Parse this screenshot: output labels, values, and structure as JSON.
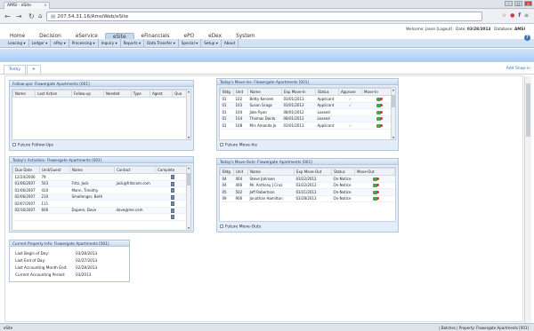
{
  "browser": {
    "tab_title": "AMSI - eSite",
    "url": "207.54.31.16/AmsiWeb/eSite"
  },
  "header": {
    "welcome_label": "Welcome: ",
    "user": "Jason [Logout]",
    "date_label": "Date: ",
    "date": "03/28/2013",
    "database_label": "Database: ",
    "database": "AMSI"
  },
  "main_nav": [
    "Home",
    "Decision",
    "eService",
    "eSite",
    "eFinancials",
    "ePO",
    "eDex",
    "System"
  ],
  "sub_nav": [
    "Leasing ▾",
    "Ledger ▾",
    "ePay ▾",
    "Processing ▾",
    "Inquiry ▾",
    "Reports ▾",
    "Data Transfer ▾",
    "Special ▾",
    "Setup ▾",
    "About"
  ],
  "page_tabs": {
    "active": "Today",
    "add": "+",
    "add_snapin": "Add Snap-in"
  },
  "followups": {
    "title": "Follow-ups: Flowergate Apartments [001]",
    "columns": [
      "Name",
      "Last Action",
      "Follow-up",
      "Needed",
      "Type",
      "Agent",
      "Que"
    ],
    "checkbox": "Future Follow-Ups"
  },
  "activities": {
    "title": "Today's Activities: Flowergate Apartments [001]",
    "columns": [
      "Due Date",
      "Unit/Guest",
      "Name",
      "Contact",
      "Complete"
    ],
    "rows": [
      [
        "12/24/2006",
        "79",
        "",
        ""
      ],
      [
        "01/06/2007",
        "503",
        "Fritz, Jack",
        "jack@fritzcom.com"
      ],
      [
        "01/06/2007",
        "410",
        "Mann, Timothy",
        ""
      ],
      [
        "02/06/2007",
        "210",
        "Smallenger, Beth",
        ""
      ],
      [
        "02/07/2007",
        "111",
        "",
        ""
      ],
      [
        "02/16/2007",
        "606",
        "Dupere, Dave",
        "dave@me.com"
      ],
      [
        "",
        "",
        "",
        ""
      ]
    ]
  },
  "move_ins": {
    "title": "Today's Move-Ins: Flowergate Apartments [001]",
    "columns": [
      "Bldg",
      "Unit",
      "Name",
      "Exp Move-In",
      "Status",
      "Approve",
      "Move-In"
    ],
    "rows": [
      [
        "01",
        "102",
        "Betty Kersem",
        "03/01/2013",
        "Applicant",
        "✓"
      ],
      [
        "01",
        "103",
        "Susan Grags",
        "03/01/2013",
        "Applicant",
        "✓"
      ],
      [
        "01",
        "104",
        "Jake Ryan",
        "08/01/2012",
        "Leased",
        ""
      ],
      [
        "01",
        "104",
        "Thomas Donla",
        "08/01/2012",
        "Leased",
        ""
      ],
      [
        "01",
        "108",
        "Mrs Amanda Jo",
        "03/01/2013",
        "Applicant",
        "✓"
      ]
    ],
    "checkbox": "Future Move-Ins"
  },
  "move_outs": {
    "title": "Today's Move-Outs: Flowergate Apartments [001]",
    "columns": [
      "Bldg",
      "Unit",
      "Name",
      "Exp Move-Out",
      "Status",
      "Move-Out"
    ],
    "rows": [
      [
        "04",
        "404",
        "Steve Johnson",
        "03/22/2012",
        "On-Notice"
      ],
      [
        "04",
        "406",
        "Mr. Anthony J Cruz",
        "03/22/2012",
        "On-Notice"
      ],
      [
        "05",
        "502",
        "Jeff Robertson",
        "03/21/2012",
        "On-Notice"
      ],
      [
        "09",
        "906",
        "Jonathan Hamilton",
        "03/28/2013",
        "On-Notice"
      ]
    ],
    "checkbox": "Future Move-Outs"
  },
  "property_info": {
    "title": "Current Property Info: Flowergate Apartments [001]",
    "items": [
      {
        "label": "Last Begin of Day:",
        "value": "03/28/2013"
      },
      {
        "label": "Last End of Day:",
        "value": "02/27/2013"
      },
      {
        "label": "Last Accounting Month End:",
        "value": "02/28/2013"
      },
      {
        "label": "Current Accounting Period:",
        "value": "03/2013"
      }
    ]
  },
  "status_bar": {
    "left": "eSite",
    "right": "| Batches | Property: Flowergate Apartments [001]"
  }
}
